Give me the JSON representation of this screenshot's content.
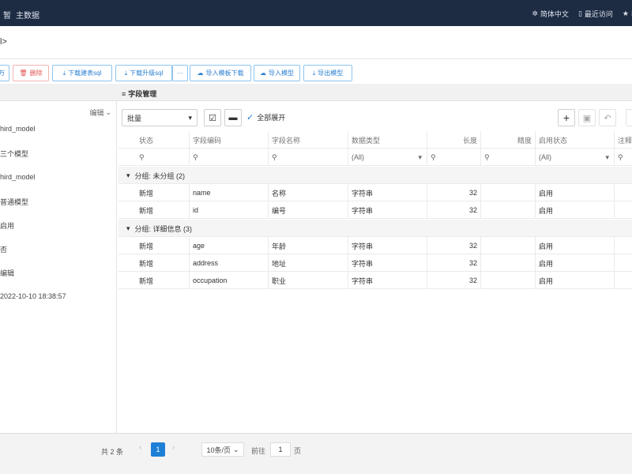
{
  "topbar": {
    "brand_short": "暂",
    "brand_title": "主数据",
    "lang": "简体中文",
    "recent": "最近访问",
    "fav": "收"
  },
  "crumb": {
    "text": "l>"
  },
  "toolbar": {
    "btn_a": "万",
    "delete": "删除",
    "download_table_sql": "下载建表sql",
    "download_upgrade_sql": "下载升级sql",
    "more": "···",
    "import_template_download": "导入模板下载",
    "import_model": "导入模型",
    "export_model": "导出模型"
  },
  "left": {
    "edit": "编辑",
    "rows": [
      "hird_model",
      "三个模型",
      "hird_model",
      "普通模型",
      "启用",
      "否",
      "编辑",
      "2022-10-10 18:38:57"
    ]
  },
  "panel": {
    "title": "字段管理",
    "batch": "批量",
    "expand_all": "全部展开"
  },
  "grid": {
    "headers": [
      "状态",
      "字段编码",
      "字段名称",
      "数据类型",
      "长度",
      "精度",
      "启用状态",
      "注释"
    ],
    "filter_all": "(All)",
    "groups": [
      {
        "label": "分组: 未分组 (2)",
        "rows": [
          {
            "status": "新增",
            "code": "name",
            "name": "名称",
            "type": "字符串",
            "length": "32",
            "enabled": "启用"
          },
          {
            "status": "新增",
            "code": "id",
            "name": "编号",
            "type": "字符串",
            "length": "32",
            "enabled": "启用"
          }
        ]
      },
      {
        "label": "分组: 详细信息 (3)",
        "rows": [
          {
            "status": "新增",
            "code": "age",
            "name": "年龄",
            "type": "字符串",
            "length": "32",
            "enabled": "启用"
          },
          {
            "status": "新增",
            "code": "address",
            "name": "地址",
            "type": "字符串",
            "length": "32",
            "enabled": "启用"
          },
          {
            "status": "新增",
            "code": "occupation",
            "name": "职业",
            "type": "字符串",
            "length": "32",
            "enabled": "启用"
          }
        ]
      }
    ]
  },
  "pager": {
    "total": "共 2 条",
    "page": "1",
    "size": "10条/页",
    "goto": "前往",
    "goto_value": "1",
    "unit": "页"
  },
  "colors": {
    "topbar": "#1d2b43",
    "accent": "#1e7fd6",
    "danger": "#e25151"
  }
}
